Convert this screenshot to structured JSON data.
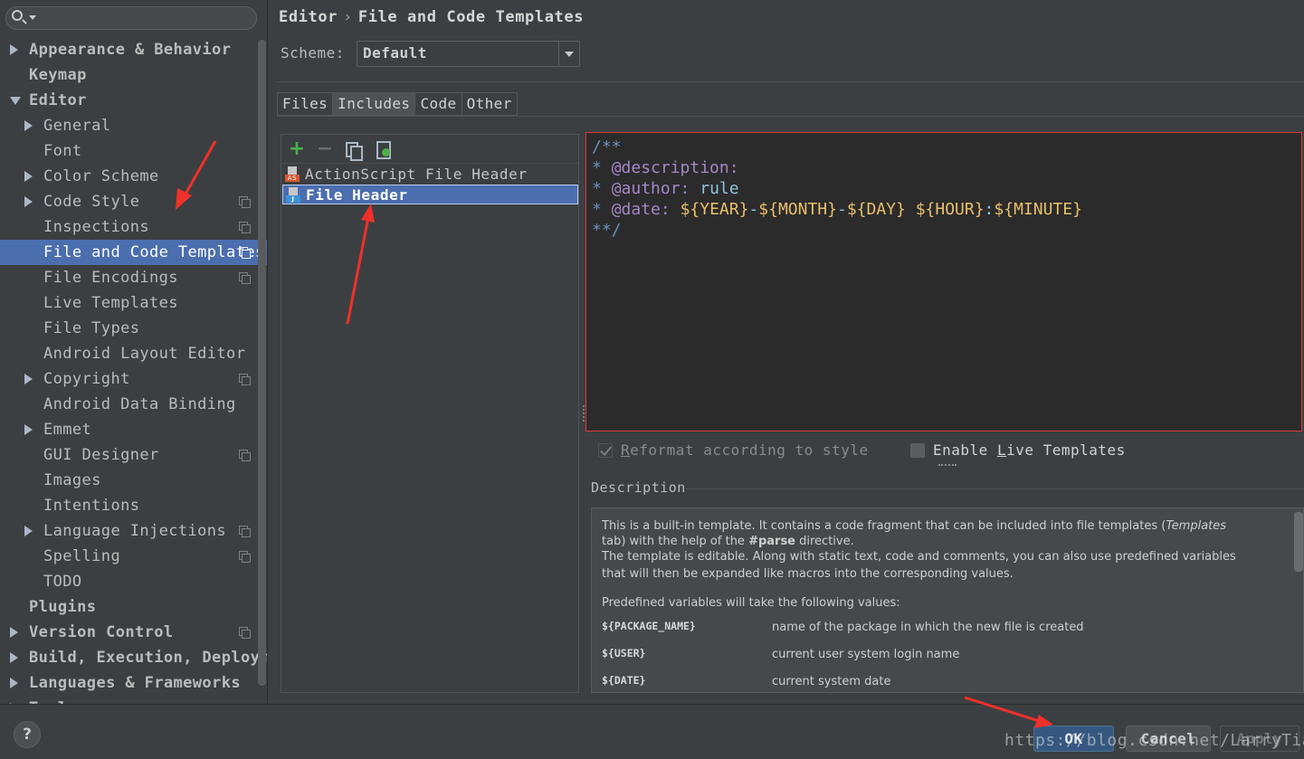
{
  "sidebar": {
    "search_placeholder": "",
    "items": [
      {
        "label": "Appearance & Behavior",
        "level": 0,
        "arrow": "right",
        "bold": true,
        "copy": false
      },
      {
        "label": "Keymap",
        "level": 0,
        "arrow": "",
        "bold": true,
        "copy": false
      },
      {
        "label": "Editor",
        "level": 0,
        "arrow": "down",
        "bold": true,
        "copy": false
      },
      {
        "label": "General",
        "level": 1,
        "arrow": "right",
        "bold": false,
        "copy": false
      },
      {
        "label": "Font",
        "level": 1,
        "arrow": "",
        "bold": false,
        "copy": false
      },
      {
        "label": "Color Scheme",
        "level": 1,
        "arrow": "right",
        "bold": false,
        "copy": false
      },
      {
        "label": "Code Style",
        "level": 1,
        "arrow": "right",
        "bold": false,
        "copy": true
      },
      {
        "label": "Inspections",
        "level": 1,
        "arrow": "",
        "bold": false,
        "copy": true
      },
      {
        "label": "File and Code Templates",
        "level": 1,
        "arrow": "",
        "bold": false,
        "copy": true,
        "selected": true
      },
      {
        "label": "File Encodings",
        "level": 1,
        "arrow": "",
        "bold": false,
        "copy": true
      },
      {
        "label": "Live Templates",
        "level": 1,
        "arrow": "",
        "bold": false,
        "copy": false
      },
      {
        "label": "File Types",
        "level": 1,
        "arrow": "",
        "bold": false,
        "copy": false
      },
      {
        "label": "Android Layout Editor",
        "level": 1,
        "arrow": "",
        "bold": false,
        "copy": false
      },
      {
        "label": "Copyright",
        "level": 1,
        "arrow": "right",
        "bold": false,
        "copy": true
      },
      {
        "label": "Android Data Binding",
        "level": 1,
        "arrow": "",
        "bold": false,
        "copy": false
      },
      {
        "label": "Emmet",
        "level": 1,
        "arrow": "right",
        "bold": false,
        "copy": false
      },
      {
        "label": "GUI Designer",
        "level": 1,
        "arrow": "",
        "bold": false,
        "copy": true
      },
      {
        "label": "Images",
        "level": 1,
        "arrow": "",
        "bold": false,
        "copy": false
      },
      {
        "label": "Intentions",
        "level": 1,
        "arrow": "",
        "bold": false,
        "copy": false
      },
      {
        "label": "Language Injections",
        "level": 1,
        "arrow": "right",
        "bold": false,
        "copy": true
      },
      {
        "label": "Spelling",
        "level": 1,
        "arrow": "",
        "bold": false,
        "copy": true
      },
      {
        "label": "TODO",
        "level": 1,
        "arrow": "",
        "bold": false,
        "copy": false
      },
      {
        "label": "Plugins",
        "level": 0,
        "arrow": "",
        "bold": true,
        "copy": false
      },
      {
        "label": "Version Control",
        "level": 0,
        "arrow": "right",
        "bold": true,
        "copy": true
      },
      {
        "label": "Build, Execution, Deployment",
        "level": 0,
        "arrow": "right",
        "bold": true,
        "copy": false
      },
      {
        "label": "Languages & Frameworks",
        "level": 0,
        "arrow": "right",
        "bold": true,
        "copy": false
      },
      {
        "label": "Tools",
        "level": 0,
        "arrow": "right",
        "bold": true,
        "copy": false
      }
    ]
  },
  "breadcrumb": {
    "part1": "Editor",
    "separator": "›",
    "part2": "File and Code Templates"
  },
  "scheme": {
    "label": "Scheme:",
    "value": "Default"
  },
  "tabs": [
    {
      "label": "Files",
      "active": false
    },
    {
      "label": "Includes",
      "active": true
    },
    {
      "label": "Code",
      "active": false
    },
    {
      "label": "Other",
      "active": false
    }
  ],
  "template_list": {
    "toolbar": {
      "add": "+",
      "remove": "−"
    },
    "items": [
      {
        "label": "ActionScript File Header",
        "icon": "actionscript-file-icon",
        "icon_tag": "AS",
        "selected": false
      },
      {
        "label": "File Header",
        "icon": "java-file-icon",
        "icon_tag": "J",
        "selected": true
      }
    ]
  },
  "code": {
    "line1": "/**",
    "line2_star": "* ",
    "line2_tag": "@description:",
    "line3_star": "* ",
    "line3_tag": "@author:",
    "line3_val": " rule",
    "line4_star": "* ",
    "line4_tag": "@date:",
    "line4_sp": " ",
    "v_year": "${YEAR}",
    "dash1": "-",
    "v_month": "${MONTH}",
    "dash2": "-",
    "v_day": "${DAY}",
    "sp": " ",
    "v_hour": "${HOUR}",
    "colon": ":",
    "v_minute": "${MINUTE}",
    "line5": "**/"
  },
  "options": {
    "reformat_pre": "",
    "reformat_u": "R",
    "reformat_post": "eformat according to style",
    "reformat_checked": true,
    "live_pre": "Enable ",
    "live_u": "L",
    "live_post": "ive Templates",
    "live_checked": false
  },
  "description": {
    "title": "Description",
    "p1a": "This is a built-in template. It contains a code fragment that can be included into file templates (",
    "p1b": "Templates",
    "p2a": "tab) with the help of the ",
    "p2b": "#parse",
    "p2c": " directive.",
    "p3": "The template is editable. Along with static text, code and comments, you can also use predefined variables",
    "p4": "that will then be expanded like macros into the corresponding values.",
    "p5": "Predefined variables will take the following values:",
    "vars": [
      {
        "name": "${PACKAGE_NAME}",
        "desc": "name of the package in which the new file is created"
      },
      {
        "name": "${USER}",
        "desc": "current user system login name"
      },
      {
        "name": "${DATE}",
        "desc": "current system date"
      }
    ]
  },
  "footer": {
    "help": "?",
    "ok": "OK",
    "cancel": "Cancel",
    "apply": "Apply",
    "watermark": "https://blog.csdn.net/LarryTiaal"
  },
  "colors": {
    "accent_selection": "#4b6eaf",
    "annotation_arrow": "#f0302a",
    "editor_bg": "#2b2b2b",
    "editor_border": "#e0383e"
  }
}
